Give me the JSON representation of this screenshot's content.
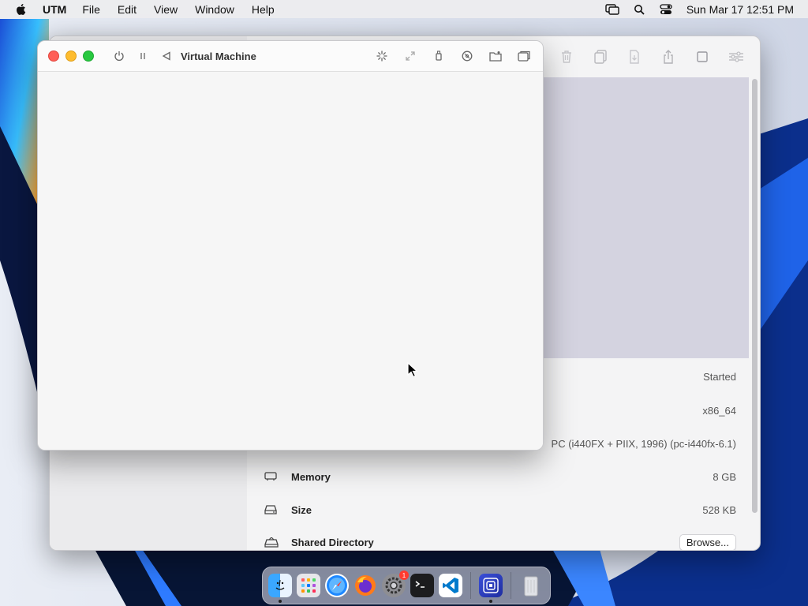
{
  "menubar": {
    "app_name": "UTM",
    "menus": [
      "File",
      "Edit",
      "View",
      "Window",
      "Help"
    ],
    "clock": "Sun Mar 17  12:51 PM",
    "status_icons": [
      "screen-mirroring-icon",
      "spotlight-search-icon",
      "control-center-icon"
    ]
  },
  "vm_window": {
    "title": "Virtual Machine",
    "left_controls": [
      "power-icon",
      "pause-icon",
      "restart-icon"
    ],
    "right_controls": [
      "spinner-icon",
      "resize-icon",
      "usb-icon",
      "disc-icon",
      "shared-folder-icon",
      "windows-icon"
    ]
  },
  "main_window": {
    "toolbar_icons": [
      "trash-icon",
      "clone-icon",
      "download-icon",
      "share-icon",
      "stop-icon",
      "settings-icon"
    ],
    "info": {
      "status_value": "Started",
      "arch_value": "x86_64",
      "machine_value": "PC (i440FX + PIIX, 1996) (pc-i440fx-6.1)",
      "memory_label": "Memory",
      "memory_value": "8 GB",
      "size_label": "Size",
      "size_value": "528 KB",
      "shared_label": "Shared Directory",
      "browse_label": "Browse..."
    }
  },
  "dock": {
    "apps": [
      "Finder",
      "Launchpad",
      "Safari",
      "Firefox",
      "System Settings",
      "Terminal",
      "Visual Studio Code",
      "UTM",
      "Trash"
    ],
    "settings_badge": "1"
  },
  "colors": {
    "red": "#ff5f57",
    "yellow": "#febc2e",
    "green": "#28c840",
    "preview_bg": "#d4d3e0"
  }
}
